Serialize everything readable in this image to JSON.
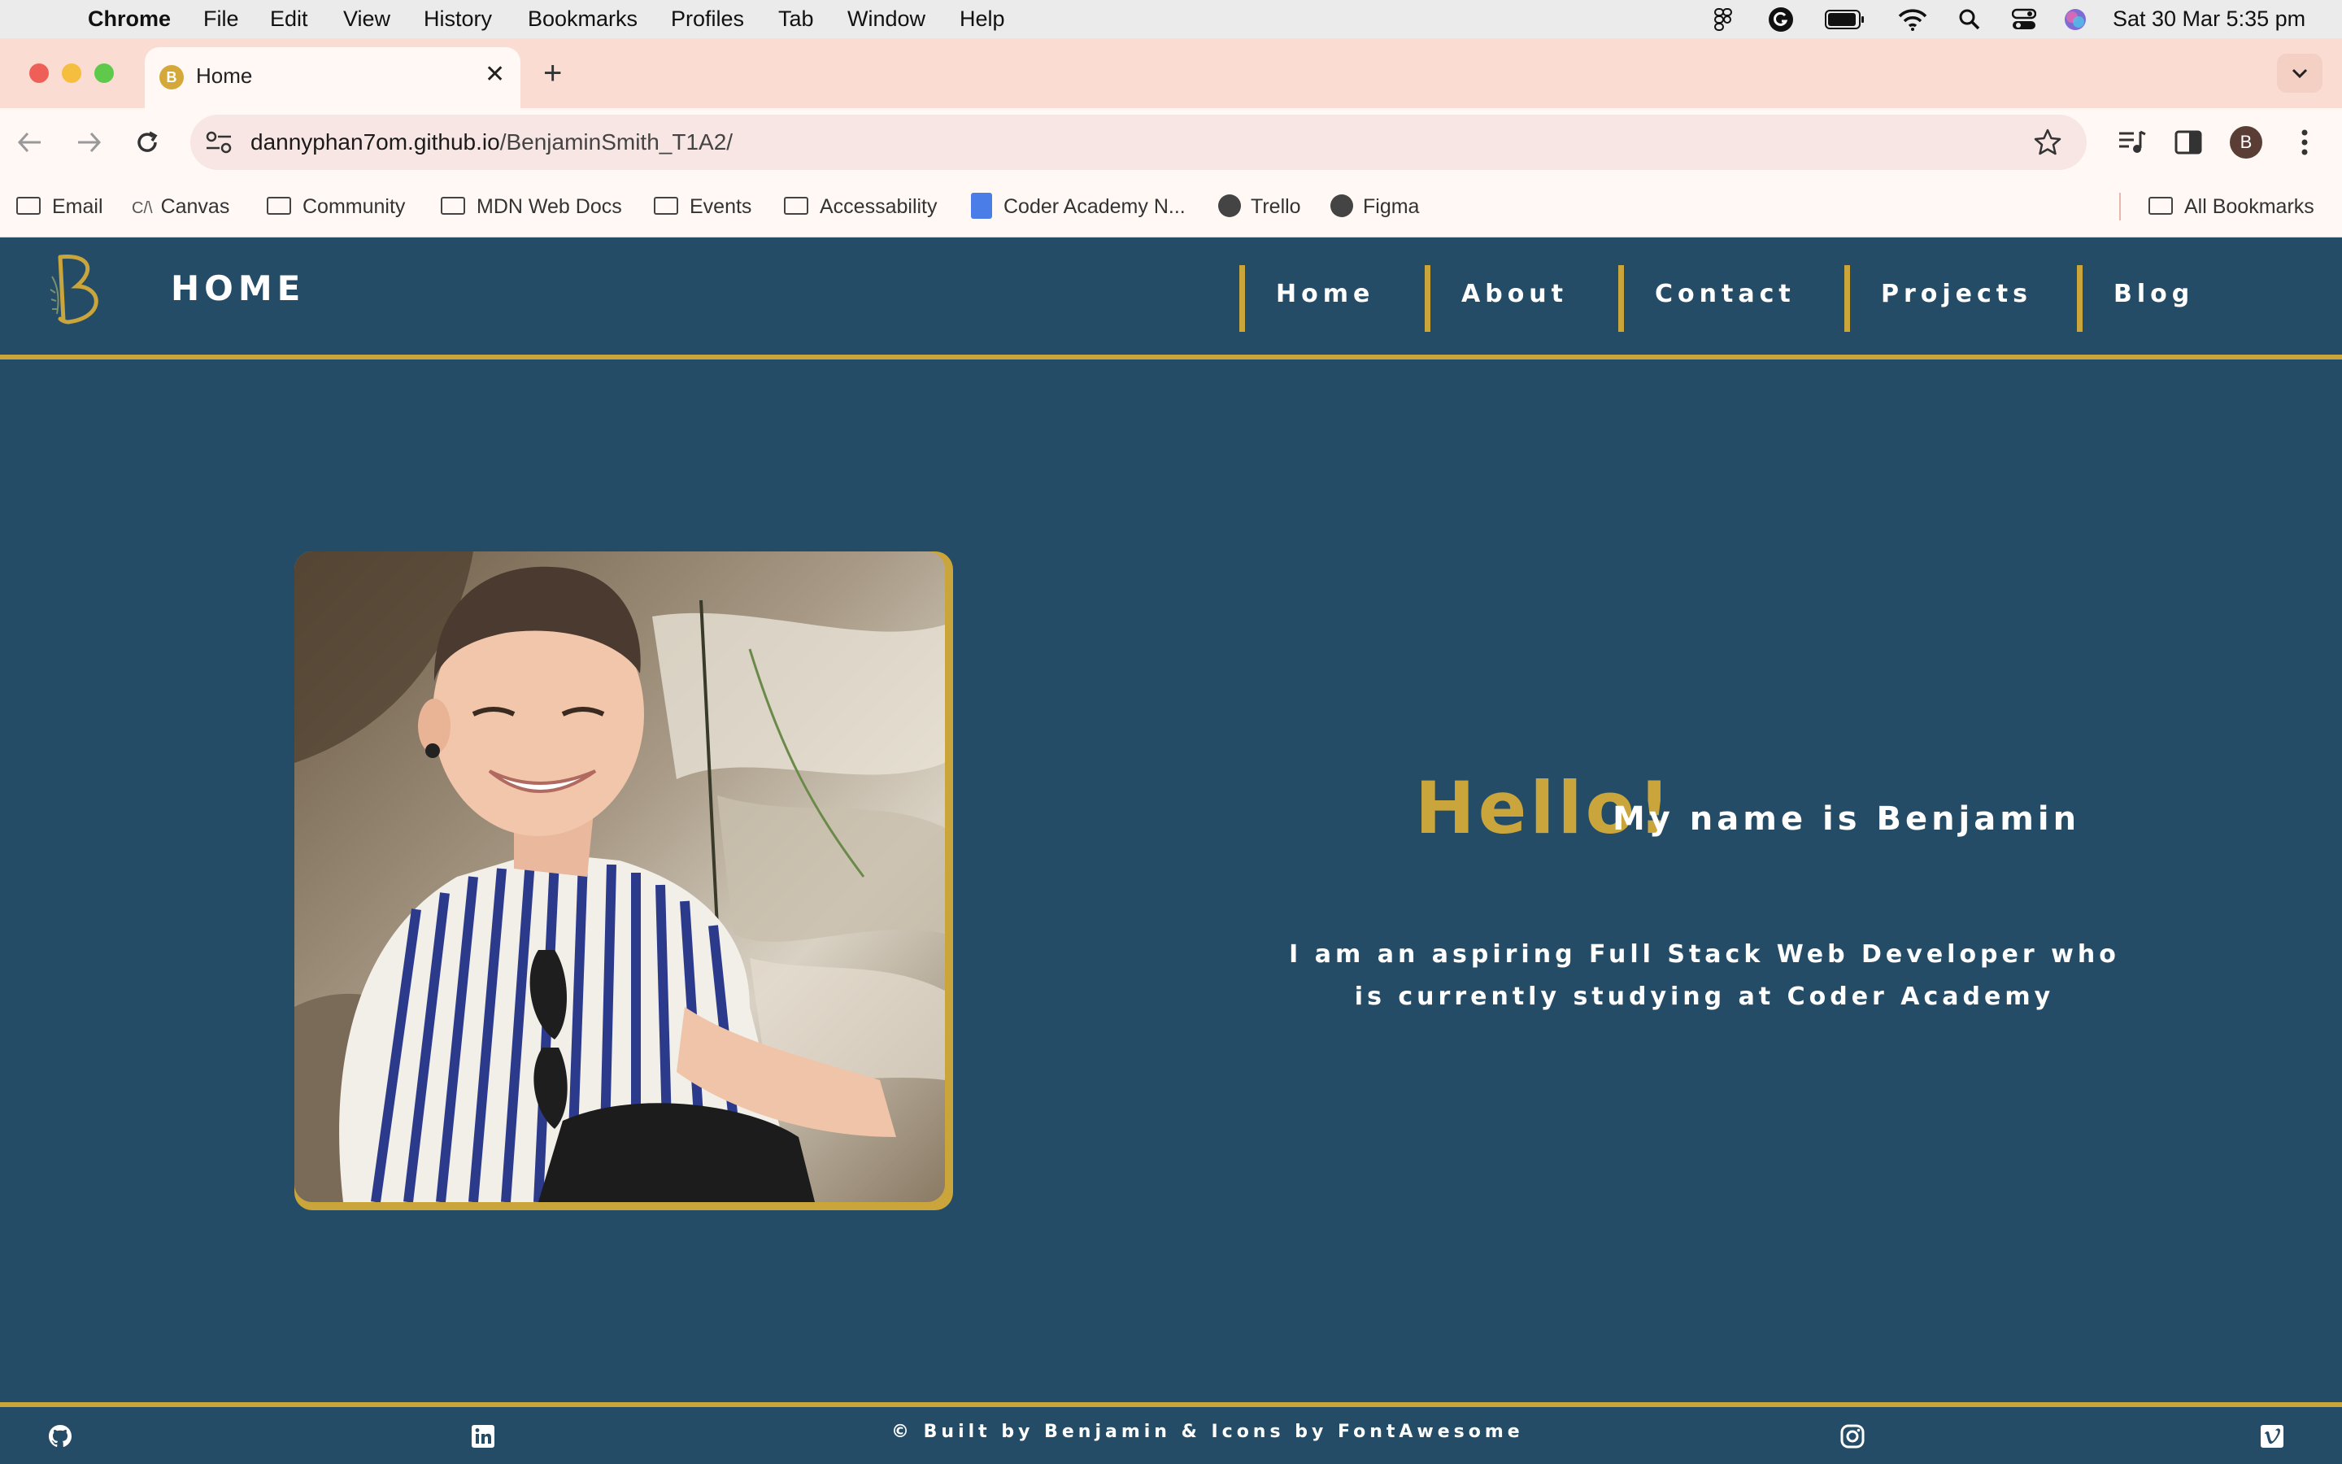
{
  "menubar": {
    "app": "Chrome",
    "items": [
      "File",
      "Edit",
      "View",
      "History",
      "Bookmarks",
      "Profiles",
      "Tab",
      "Window",
      "Help"
    ],
    "datetime": "Sat 30 Mar  5:35 pm"
  },
  "tab": {
    "title": "Home",
    "favicon_letter": "B"
  },
  "toolbar": {
    "url_domain": "dannyphan7om.github.io",
    "url_path": "/BenjaminSmith_T1A2/",
    "profile_letter": "B"
  },
  "bookmarks": {
    "items": [
      "Email",
      "Canvas",
      "Community",
      "MDN Web Docs",
      "Events",
      "Accessability",
      "Coder Academy N...",
      "Trello",
      "Figma"
    ],
    "all_bookmarks": "All Bookmarks",
    "canvas_icon": "C/\\"
  },
  "site": {
    "heading": "HOME",
    "nav": [
      "Home",
      "About",
      "Contact",
      "Projects",
      "Blog"
    ],
    "hello": "Hello!",
    "name_line": "My name is Benjamin",
    "bio": "I am an aspiring Full Stack Web Developer who is currently studying at Coder Academy",
    "footer": "© Built by Benjamin & Icons by FontAwesome"
  },
  "colors": {
    "accent": "#c9a53b",
    "background": "#254c66"
  },
  "icons": {
    "footer": [
      "github-icon",
      "linkedin-icon",
      "instagram-icon",
      "vimeo-icon"
    ]
  }
}
